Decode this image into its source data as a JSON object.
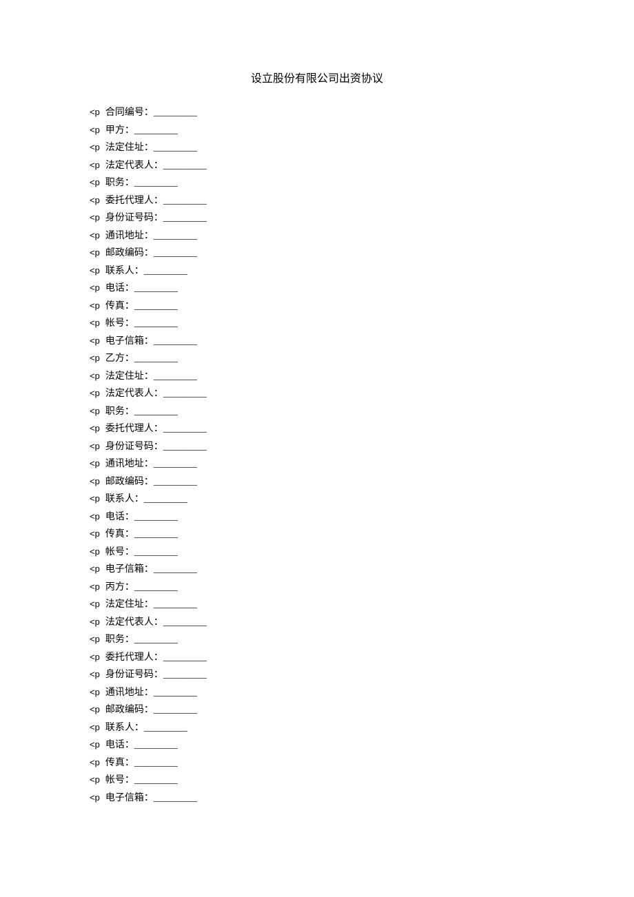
{
  "title": "设立股份有限公司出资协议",
  "tag_prefix": "<p",
  "blank": "_________",
  "fields": [
    "合同编号：",
    "甲方：",
    "法定住址：",
    "法定代表人：",
    "职务：",
    "委托代理人：",
    "身份证号码：",
    "通讯地址：",
    "邮政编码：",
    "联系人：",
    "电话：",
    "传真：",
    "帐号：",
    "电子信箱：",
    "乙方：",
    "法定住址：",
    "法定代表人：",
    "职务：",
    "委托代理人：",
    "身份证号码：",
    "通讯地址：",
    "邮政编码：",
    "联系人：",
    "电话：",
    "传真：",
    "帐号：",
    "电子信箱：",
    "丙方：",
    "法定住址：",
    "法定代表人：",
    "职务：",
    "委托代理人：",
    "身份证号码：",
    "通讯地址：",
    "邮政编码：",
    "联系人：",
    "电话：",
    "传真：",
    "帐号：",
    "电子信箱："
  ]
}
